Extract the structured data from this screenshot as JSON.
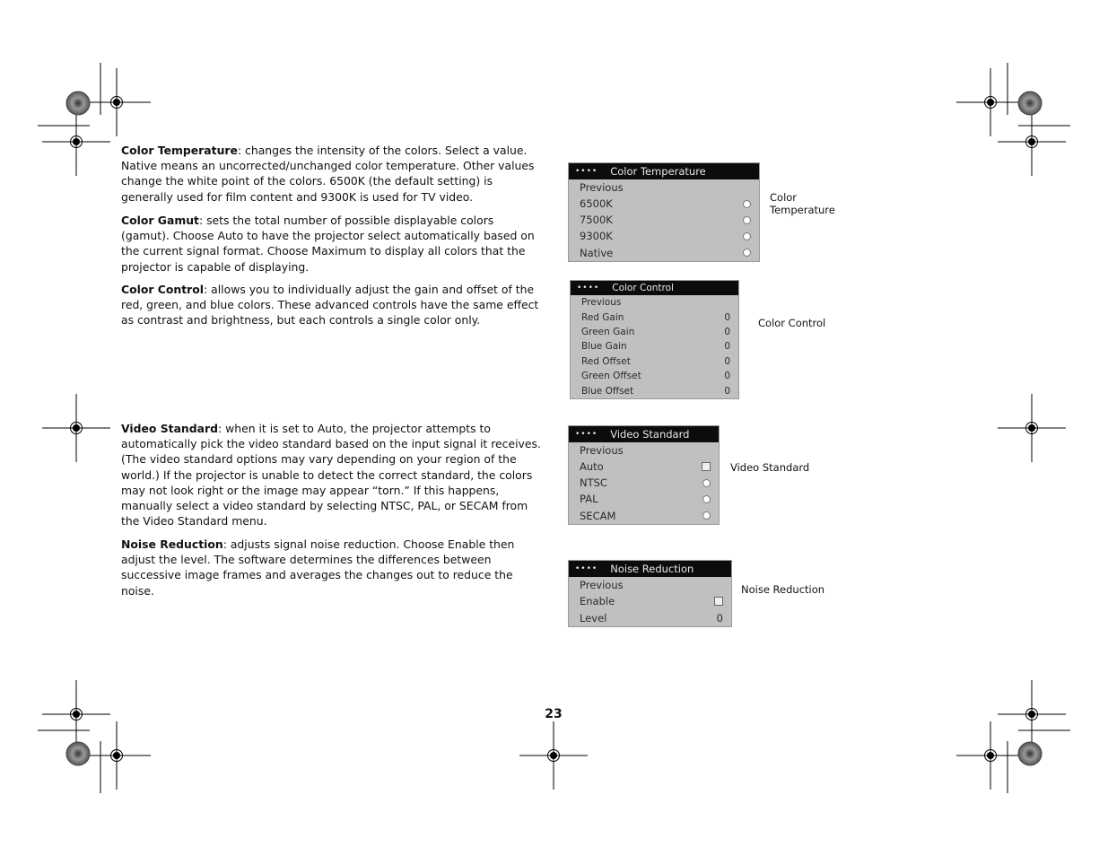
{
  "paragraphs": [
    {
      "term": "Color Temperature",
      "text": ": changes the intensity of the colors. Select a value. Native means an uncorrected/unchanged color temperature. Other values change the white point of the colors. 6500K (the default setting) is generally used for film content and 9300K is used for TV video."
    },
    {
      "term": "Color Gamut",
      "text": ": sets the total number of possible displayable colors (gamut). Choose Auto to have the projector select automatically based on the current signal format. Choose Maximum to display all colors that the projector is capable of displaying."
    },
    {
      "term": "Color Control",
      "text": ": allows you to individually adjust the gain and offset of the red, green, and blue colors. These advanced controls have the same effect as contrast and brightness, but each controls a single color only."
    },
    {
      "term": "Video Standard",
      "text": ": when it is set to Auto, the projector attempts to automatically pick the video standard based on the input signal it receives. (The video standard options may vary depending on your region of the world.) If the projector is unable to detect the correct standard, the colors may not look right or the image may appear “torn.” If this happens, manually select a video standard by selecting NTSC, PAL, or SECAM from the Video Standard menu."
    },
    {
      "term": "Noise Reduction",
      "text": ": adjusts signal noise reduction. Choose Enable then adjust the level. The software determines the differences between successive image frames and averages the changes out to reduce the noise."
    }
  ],
  "menus": {
    "color_temperature": {
      "dots": "••••",
      "title": "Color Temperature",
      "caption_line1": "Color",
      "caption_line2": "Temperature",
      "items": [
        {
          "label": "Previous",
          "control": "none"
        },
        {
          "label": "6500K",
          "control": "radio"
        },
        {
          "label": "7500K",
          "control": "radio"
        },
        {
          "label": "9300K",
          "control": "radio"
        },
        {
          "label": "Native",
          "control": "radio"
        }
      ]
    },
    "color_control": {
      "dots": "••••",
      "title": "Color Control",
      "caption": "Color Control",
      "items": [
        {
          "label": "Previous",
          "value": ""
        },
        {
          "label": "Red Gain",
          "value": "0"
        },
        {
          "label": "Green Gain",
          "value": "0"
        },
        {
          "label": "Blue Gain",
          "value": "0"
        },
        {
          "label": "Red Offset",
          "value": "0"
        },
        {
          "label": "Green Offset",
          "value": "0"
        },
        {
          "label": "Blue Offset",
          "value": "0"
        }
      ]
    },
    "video_standard": {
      "dots": "••••",
      "title": "Video Standard",
      "caption": "Video Standard",
      "items": [
        {
          "label": "Previous",
          "control": "none"
        },
        {
          "label": "Auto",
          "control": "checkbox"
        },
        {
          "label": "NTSC",
          "control": "radio"
        },
        {
          "label": "PAL",
          "control": "radio"
        },
        {
          "label": "SECAM",
          "control": "radio"
        }
      ]
    },
    "noise_reduction": {
      "dots": "••••",
      "title": "Noise Reduction",
      "caption": "Noise Reduction",
      "items": [
        {
          "label": "Previous",
          "value": ""
        },
        {
          "label": "Enable",
          "control": "checkbox"
        },
        {
          "label": "Level",
          "value": "0"
        }
      ]
    }
  },
  "page_number": "23"
}
